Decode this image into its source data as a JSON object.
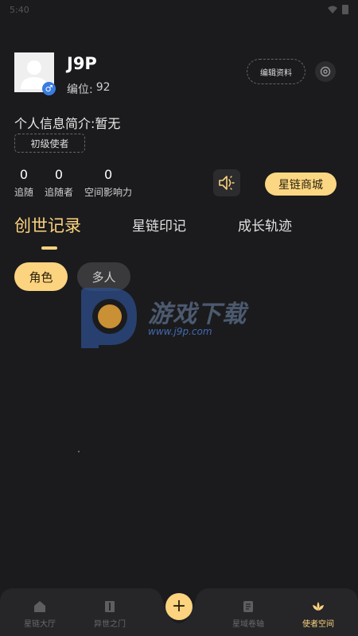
{
  "status": {
    "time": "5:40"
  },
  "profile": {
    "username": "J9P",
    "id_label": "编位:",
    "id_value": "92",
    "gender_symbol": "♂",
    "edit_label": "编辑资料"
  },
  "bio": {
    "text": "个人信息简介:暂无"
  },
  "level": {
    "label": "初级使者"
  },
  "stats": [
    {
      "value": "0",
      "label": "追随"
    },
    {
      "value": "0",
      "label": "追随者"
    },
    {
      "value": "0",
      "label": "空间影响力"
    }
  ],
  "shop_label": "星链商城",
  "tabs": [
    {
      "label": "创世记录",
      "active": true
    },
    {
      "label": "星链印记",
      "active": false
    },
    {
      "label": "成长轨迹",
      "active": false
    }
  ],
  "chips": [
    {
      "label": "角色",
      "active": true
    },
    {
      "label": "多人",
      "active": false
    }
  ],
  "watermark": {
    "text": "游戏下载",
    "url": "www.j9p.com"
  },
  "nav": [
    {
      "label": "星链大厅",
      "icon": "home-icon"
    },
    {
      "label": "异世之门",
      "icon": "door-icon"
    },
    {
      "label": "星域卷轴",
      "icon": "scroll-icon"
    },
    {
      "label": "使者空间",
      "icon": "lotus-icon",
      "active": true
    }
  ],
  "colors": {
    "accent": "#fcd37f",
    "background": "#1b1b1d",
    "gender_blue": "#3a7be0"
  }
}
